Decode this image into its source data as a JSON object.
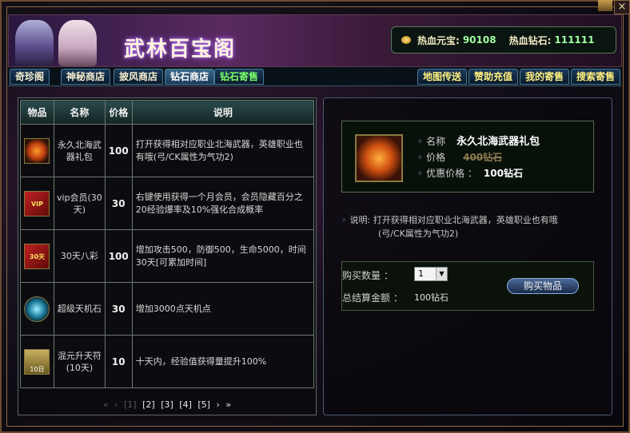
{
  "window": {
    "close_label": "×"
  },
  "header": {
    "title": "武林百宝阁",
    "currency": [
      {
        "label": "热血元宝:",
        "value": "90108"
      },
      {
        "label": "热血钻石:",
        "value": "111111"
      }
    ]
  },
  "tabs_left": [
    {
      "label": "奇珍阁",
      "style": "normal"
    },
    {
      "label": "神秘商店",
      "style": "normal"
    },
    {
      "label": "披风商店",
      "style": "normal"
    },
    {
      "label": "钻石商店",
      "style": "active"
    },
    {
      "label": "钻石寄售",
      "style": "green"
    }
  ],
  "tabs_right": [
    {
      "label": "地图传送",
      "style": "yellow"
    },
    {
      "label": "赞助充值",
      "style": "yellow"
    },
    {
      "label": "我的寄售",
      "style": "yellow"
    },
    {
      "label": "搜索寄售",
      "style": "yellow"
    }
  ],
  "table": {
    "headers": [
      "物品",
      "名称",
      "价格",
      "说明"
    ],
    "rows": [
      {
        "icon": "gift-orb-icon",
        "icon_text": "",
        "name": "永久北海武器礼包",
        "price": "100",
        "desc": "打开获得相对应职业北海武器，英雄职业也有哦(弓/CK属性为气功2)"
      },
      {
        "icon": "vip-card-icon",
        "icon_text": "VIP",
        "name": "vip会员(30天)",
        "price": "30",
        "desc": "右键使用获得一个月会员，会员隐藏百分之20经验爆率及10%强化合成概率"
      },
      {
        "icon": "vip-card-icon",
        "icon_text": "30天",
        "name": "30天八彩",
        "price": "100",
        "desc": "增加攻击500，防御500，生命5000，时间30天[可累加时间]"
      },
      {
        "icon": "gem-orb-icon",
        "icon_text": "",
        "name": "超级天机石",
        "price": "30",
        "desc": "增加3000点天机点"
      },
      {
        "icon": "scroll-icon",
        "icon_text": "10日",
        "name": "混元升天符(10天)",
        "price": "10",
        "desc": "十天内，经验值获得量提升100%"
      }
    ]
  },
  "pager": {
    "first": "«",
    "prev": "‹",
    "current": "[1]",
    "pages": [
      "[2]",
      "[3]",
      "[4]",
      "[5]"
    ],
    "next": "›",
    "last": "»"
  },
  "detail": {
    "name_label": "名称",
    "name_value": "永久北海武器礼包",
    "price_label": "价格",
    "price_old": "400钻石",
    "discount_label": "优惠价格 ：",
    "discount_value": "100钻石",
    "desc_label": "说明:",
    "desc_line1": "打开获得相对应职业北海武器，英雄职业也有哦",
    "desc_line2": "(弓/CK属性为气功2)"
  },
  "purchase": {
    "qty_label": "购买数量 ：",
    "qty_value": "1",
    "total_label": "总结算金额 ：",
    "total_value": "100钻石",
    "buy_button": "购买物品"
  }
}
